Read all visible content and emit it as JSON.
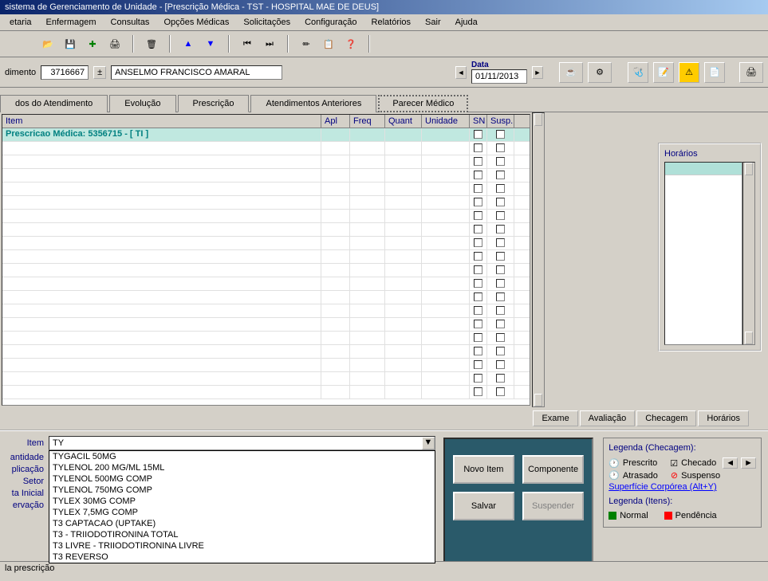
{
  "title": "sistema de Gerenciamento de Unidade - [Prescrição Médica - TST -  HOSPITAL MAE DE DEUS]",
  "menu": [
    "etaria",
    "Enfermagem",
    "Consultas",
    "Opções Médicas",
    "Solicitações",
    "Configuração",
    "Relatórios",
    "Sair",
    "Ajuda"
  ],
  "patient": {
    "label": "dimento",
    "id": "3716667",
    "name": "ANSELMO FRANCISCO AMARAL",
    "date_label": "Data",
    "date": "01/11/2013"
  },
  "tabs": [
    "dos do Atendimento",
    "Evolução",
    "Prescrição",
    "Atendimentos Anteriores",
    "Parecer Médico"
  ],
  "grid": {
    "headers": {
      "item": "Item",
      "apl": "Apl",
      "freq": "Freq",
      "quant": "Quant",
      "unidade": "Unidade",
      "sn": "SN",
      "susp": "Susp."
    },
    "row0": "Prescricao Médica: 5356715 - [ TI ]"
  },
  "side": {
    "title": "Horários"
  },
  "subtabs": [
    "Exame",
    "Avaliação",
    "Checagem",
    "Horários"
  ],
  "form": {
    "item_label": "Item",
    "item_value": "TY",
    "qty_label": "antidade",
    "apl_label": "plicação",
    "setor_label": "Setor",
    "inicial_label": "ta Inicial",
    "obs_label": "ervação",
    "options": [
      "TYGACIL 50MG",
      "TYLENOL  200 MG/ML 15ML",
      "TYLENOL 500MG COMP",
      "TYLENOL 750MG COMP",
      "TYLEX 30MG COMP",
      "TYLEX 7,5MG COMP",
      "T3  CAPTACAO (UPTAKE)",
      "T3 - TRIIODOTIRONINA TOTAL",
      "T3 LIVRE - TRIIODOTIRONINA LIVRE",
      "T3 REVERSO"
    ]
  },
  "buttons": {
    "novo": "Novo Item",
    "comp": "Componente",
    "salvar": "Salvar",
    "susp": "Suspender"
  },
  "legend": {
    "chk_title": "Legenda (Checagem):",
    "prescrito": "Prescrito",
    "checado": "Checado",
    "atrasado": "Atrasado",
    "suspenso": "Suspenso",
    "link": "Superfície Corpórea (Alt+Y)",
    "itens_title": "Legenda (Itens):",
    "normal": "Normal",
    "pendencia": "Pendência"
  },
  "status": "la prescrição"
}
